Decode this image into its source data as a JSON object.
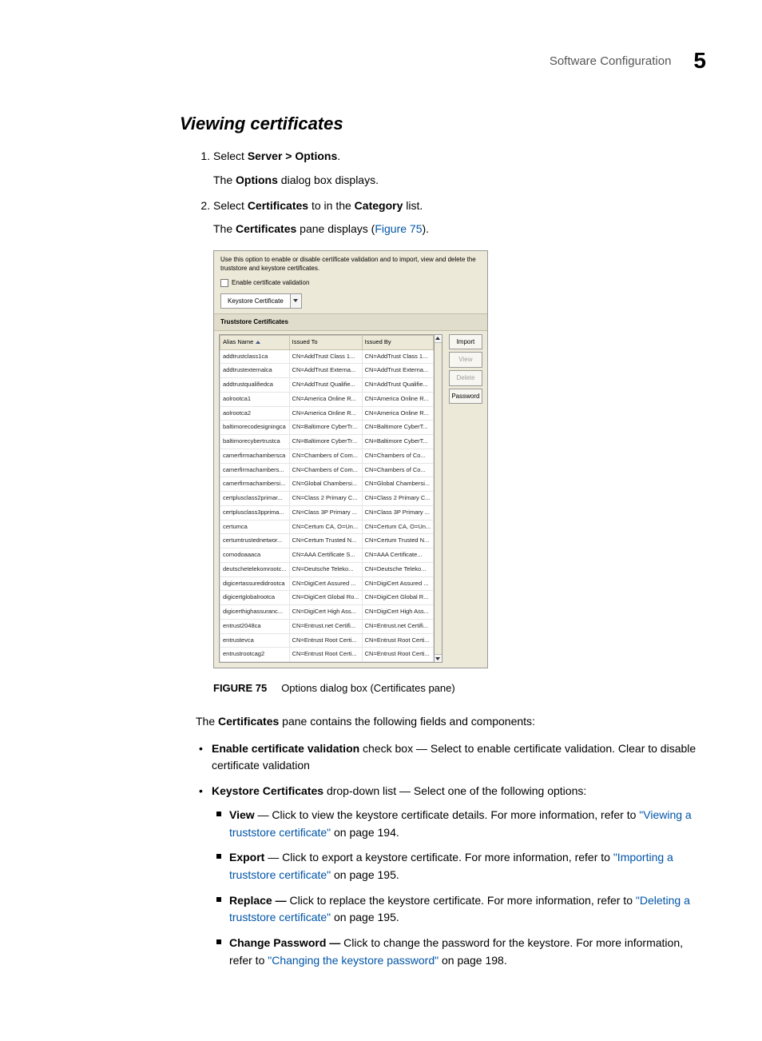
{
  "header": {
    "title": "Software Configuration",
    "chapter": "5"
  },
  "section_title": "Viewing certificates",
  "steps": [
    {
      "pre": "Select ",
      "bold": "Server > Options",
      "post": ".",
      "sub_pre": "The ",
      "sub_bold": "Options",
      "sub_post": " dialog box displays."
    },
    {
      "text_parts": {
        "p0": "Select ",
        "b0": "Certificates",
        "p1": " to in the ",
        "b1": "Category",
        "p2": " list."
      },
      "sub_parts": {
        "p0": "The ",
        "b0": "Certificates",
        "p1": " pane displays (",
        "link": "Figure 75",
        "p2": ")."
      }
    }
  ],
  "panel": {
    "desc": "Use this option to enable or disable certificate validation and to import, view and delete the truststore and keystore certificates.",
    "checkbox_label": "Enable certificate validation",
    "combo_label": "Keystore Certificate",
    "section_label": "Truststore Certificates",
    "col_alias": "Alias Name",
    "col_to": "Issued To",
    "col_by": "Issued By",
    "buttons": {
      "import": "Import",
      "view": "View",
      "delete": "Delete",
      "password": "Password"
    },
    "rows": [
      {
        "a": "addtrustclass1ca",
        "t": "CN=AddTrust Class 1...",
        "b": "CN=AddTrust Class 1..."
      },
      {
        "a": "addtrustexternalca",
        "t": "CN=AddTrust Externa...",
        "b": "CN=AddTrust Externa..."
      },
      {
        "a": "addtrustqualifiedca",
        "t": "CN=AddTrust Qualifie...",
        "b": "CN=AddTrust Qualifie..."
      },
      {
        "a": "aolrootca1",
        "t": "CN=America Online R...",
        "b": "CN=America Online R..."
      },
      {
        "a": "aolrootca2",
        "t": "CN=America Online R...",
        "b": "CN=America Online R..."
      },
      {
        "a": "baltimorecodesigningca",
        "t": "CN=Baltimore CyberTr...",
        "b": "CN=Baltimore CyberT..."
      },
      {
        "a": "baltimorecybertrustca",
        "t": "CN=Baltimore CyberTr...",
        "b": "CN=Baltimore CyberT..."
      },
      {
        "a": "camerfirmachambersca",
        "t": "CN=Chambers of Com...",
        "b": "CN=Chambers of Co..."
      },
      {
        "a": "camerfirmachambers...",
        "t": "CN=Chambers of Com...",
        "b": "CN=Chambers of Co..."
      },
      {
        "a": "camerfirmachambersi...",
        "t": "CN=Global Chambersi...",
        "b": "CN=Global Chambersi..."
      },
      {
        "a": "certplusclass2primar...",
        "t": "CN=Class 2 Primary C...",
        "b": "CN=Class 2 Primary C..."
      },
      {
        "a": "certplusclass3pprima...",
        "t": "CN=Class 3P Primary ...",
        "b": "CN=Class 3P Primary ..."
      },
      {
        "a": "certumca",
        "t": "CN=Certum CA, O=Un...",
        "b": "CN=Certum CA, O=Un..."
      },
      {
        "a": "certumtrustednetwor...",
        "t": "CN=Certum Trusted N...",
        "b": "CN=Certum Trusted N..."
      },
      {
        "a": "comodoaaaca",
        "t": "CN=AAA Certificate S...",
        "b": "CN=AAA Certificate..."
      },
      {
        "a": "deutschetelekomrootc...",
        "t": "CN=Deutsche Teleko...",
        "b": "CN=Deutsche Teleko..."
      },
      {
        "a": "digicertassuredidrootca",
        "t": "CN=DigiCert Assured ...",
        "b": "CN=DigiCert Assured ..."
      },
      {
        "a": "digicertglobalrootca",
        "t": "CN=DigiCert Global Ro...",
        "b": "CN=DigiCert Global R..."
      },
      {
        "a": "digicerthighassuranc...",
        "t": "CN=DigiCert High Ass...",
        "b": "CN=DigiCert High Ass..."
      },
      {
        "a": "entrust2048ca",
        "t": "CN=Entrust.net Certifi...",
        "b": "CN=Entrust.net Certifi..."
      },
      {
        "a": "entrustevca",
        "t": "CN=Entrust Root Certi...",
        "b": "CN=Entrust Root Certi..."
      },
      {
        "a": "entrustrootcag2",
        "t": "CN=Entrust Root Certi...",
        "b": "CN=Entrust Root Certi..."
      }
    ]
  },
  "figure_caption": {
    "num": "FIGURE 75",
    "text": "Options dialog box (Certificates pane)"
  },
  "body_para": {
    "p0": "The ",
    "b0": "Certificates",
    "p1": " pane contains the following fields and components:"
  },
  "field_list": [
    {
      "b": "Enable certificate validation",
      "tail": " check box — Select to enable certificate validation. Clear to disable certificate validation"
    },
    {
      "b": "Keystore Certificates",
      "tail": " drop-down list — Select one of the following options:"
    }
  ],
  "sub_list": [
    {
      "b": "View",
      "t": " — Click to view the keystore certificate details. For more information, refer to ",
      "link": "\"Viewing a truststore certificate\"",
      "page": " on page 194."
    },
    {
      "b": "Export",
      "t": " — Click to export a keystore certificate. For more information, refer to ",
      "link": "\"Importing a truststore certificate\"",
      "page": " on page 195."
    },
    {
      "b": "Replace —",
      "t": " Click to replace the keystore certificate. For more information, refer to ",
      "link": "\"Deleting a truststore certificate\"",
      "page": " on page 195."
    },
    {
      "b": "Change Password —",
      "t": " Click to change the password for the keystore. For more information, refer to ",
      "link": "\"Changing the keystore password\"",
      "page": " on page 198."
    }
  ]
}
